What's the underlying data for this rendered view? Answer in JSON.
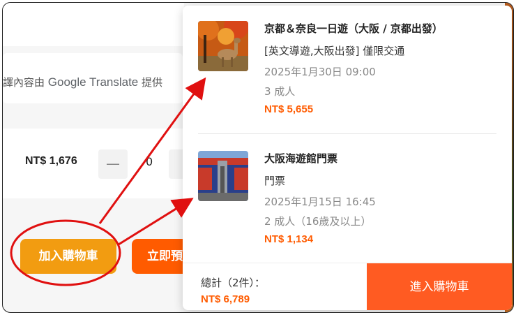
{
  "background_page": {
    "translate_note_prefix": "譯內容由",
    "translate_brand": "Google Translate",
    "translate_note_suffix": "提供",
    "unit_price": "NT$ 1,676",
    "qty_minus": "—",
    "qty_value": "0",
    "add_to_cart_label": "加入購物車",
    "buy_now_label": "立即預"
  },
  "cart_popup": {
    "items": [
      {
        "thumb": "autumn-deer-photo",
        "title": "京都＆奈良一日遊（大阪 / 京都出發）",
        "option": "[英文導遊,大阪出發] 僅限交通",
        "datetime": "2025年1月30日 09:00",
        "quantity": "3 成人",
        "price": "NT$ 5,655"
      },
      {
        "thumb": "aquarium-building-photo",
        "title": "大阪海遊館門票",
        "option": "門票",
        "datetime": "2025年1月15日 16:45",
        "quantity": "2 成人（16歲及以上）",
        "price": "NT$ 1,134"
      }
    ],
    "total_label": "總計（2件）：",
    "total_price": "NT$ 6,789",
    "checkout_label": "進入購物車"
  },
  "annotation": {
    "color": "#e01010"
  },
  "colors": {
    "accent_orange": "#ff5b00",
    "cart_button_yellow": "#f29c11"
  }
}
